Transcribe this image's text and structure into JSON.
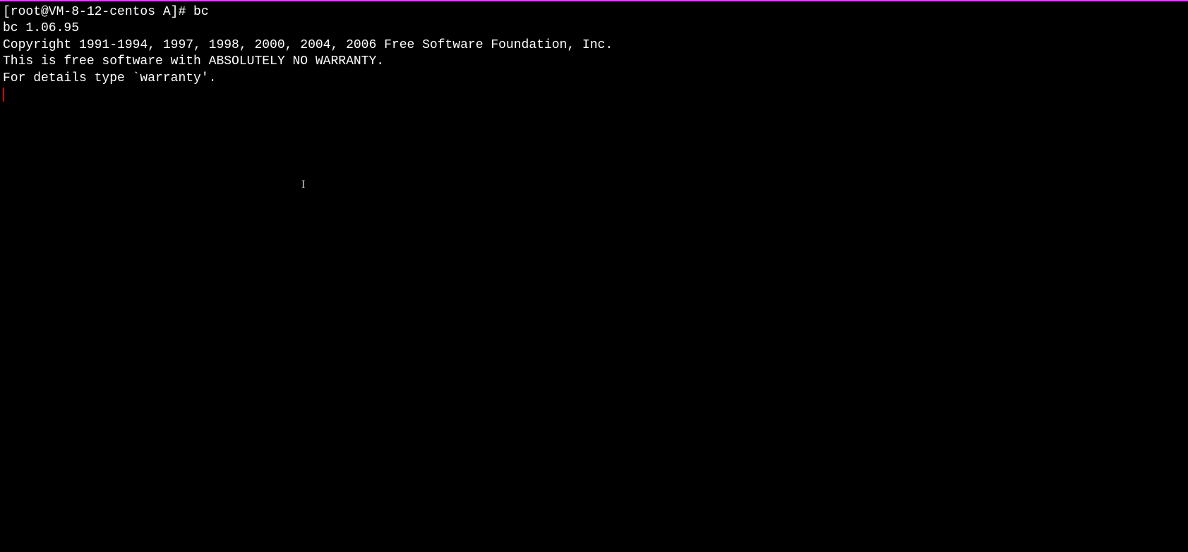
{
  "terminal": {
    "prompt": "[root@VM-8-12-centos A]# ",
    "command": "bc",
    "output": {
      "line1": "bc 1.06.95",
      "line2": "Copyright 1991-1994, 1997, 1998, 2000, 2004, 2006 Free Software Foundation, Inc.",
      "line3": "This is free software with ABSOLUTELY NO WARRANTY.",
      "line4": "For details type `warranty'."
    }
  }
}
